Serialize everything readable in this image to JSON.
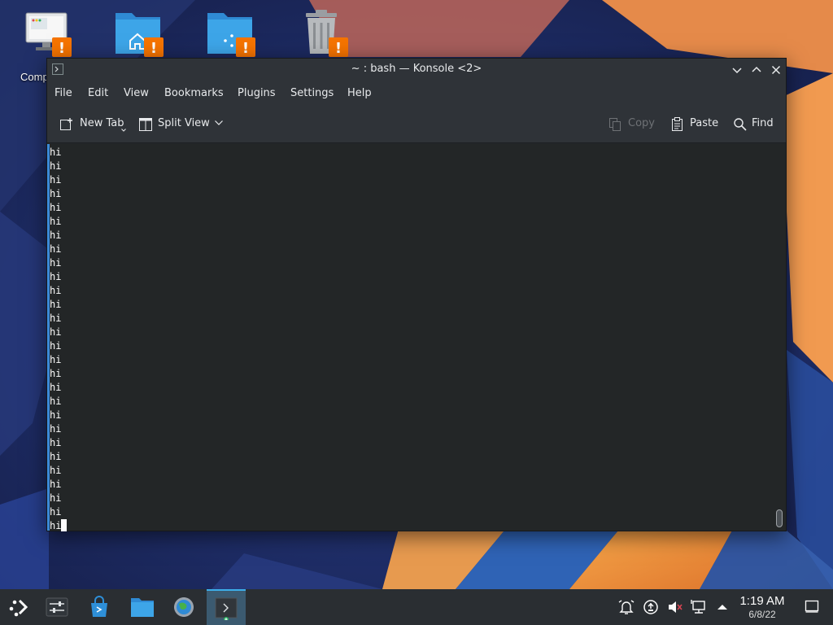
{
  "desktop": {
    "icons": [
      {
        "label": "Comp"
      },
      {
        "label": ""
      },
      {
        "label": ""
      },
      {
        "label": ""
      }
    ]
  },
  "window": {
    "title": "~ : bash — Konsole <2>",
    "menu": {
      "file": "File",
      "edit": "Edit",
      "view": "View",
      "bookmarks": "Bookmarks",
      "plugins": "Plugins",
      "settings": "Settings",
      "help": "Help"
    },
    "toolbar": {
      "new_tab": "New Tab",
      "split_view": "Split View",
      "copy": "Copy",
      "paste": "Paste",
      "find": "Find"
    }
  },
  "terminal": {
    "lines": [
      "hi",
      "hi",
      "hi",
      "hi",
      "hi",
      "hi",
      "hi",
      "hi",
      "hi",
      "hi",
      "hi",
      "hi",
      "hi",
      "hi",
      "hi",
      "hi",
      "hi",
      "hi",
      "hi",
      "hi",
      "hi",
      "hi",
      "hi",
      "hi",
      "hi",
      "hi",
      "hi",
      "hi"
    ]
  },
  "taskbar": {
    "clock_time": "1:19 AM",
    "clock_date": "6/8/22"
  },
  "colors": {
    "accent": "#3daee9",
    "warning": "#f67400",
    "terminal_bg": "#232627",
    "terminal_fg": "#fcfcfc"
  }
}
